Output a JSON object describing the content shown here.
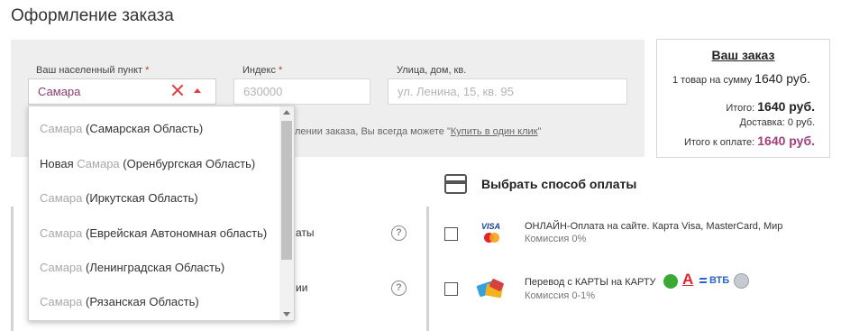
{
  "page": {
    "title": "Оформление заказа"
  },
  "form": {
    "city": {
      "label": "Ваш населенный пункт",
      "required_mark": "*",
      "value": "Самара"
    },
    "zip": {
      "label": "Индекс",
      "required_mark": "*",
      "placeholder": "630000"
    },
    "street": {
      "label": "Улица, дом, кв.",
      "placeholder": "ул. Ленина, 15, кв. 95"
    },
    "hint": {
      "text": "лении заказа, Вы всегда можете \"",
      "link": "Купить в один клик",
      "tail": "\""
    }
  },
  "order": {
    "title": "Ваш заказ",
    "summary_prefix": "1 товар на сумму",
    "summary_amount": "1640 руб.",
    "total_label": "Итого:",
    "total_amount": "1640 руб.",
    "delivery": "Доставка: 0 руб.",
    "pay_label": "Итого к оплате:",
    "pay_amount": "1640 руб.",
    "accent_color": "#a13e7b"
  },
  "city_dropdown": {
    "items": [
      {
        "pre": "",
        "match": "Самара",
        "post": " (Самарская Область)"
      },
      {
        "pre": "Новая ",
        "match": "Самара",
        "post": " (Оренбургская Область)"
      },
      {
        "pre": "",
        "match": "Самара",
        "post": " (Иркутская Область)"
      },
      {
        "pre": "",
        "match": "Самара",
        "post": " (Еврейская Автономная область)"
      },
      {
        "pre": "",
        "match": "Самара",
        "post": " (Ленинградская Область)"
      },
      {
        "pre": "",
        "match": "Самара",
        "post": " (Рязанская Область)"
      }
    ]
  },
  "delivery_partial": {
    "row1": "аты",
    "row2": "ии"
  },
  "payment": {
    "header": "Выбрать способ оплаты",
    "options": [
      {
        "title": "ОНЛАЙН-Оплата на сайте. Карта Visa, MasterCard, Мир",
        "commission": "Комиссия 0%",
        "icon": "visa-mastercard-icon"
      },
      {
        "title": "Перевод с КАРТЫ на КАРТУ",
        "commission": "Комиссия 0-1%",
        "icon": "bank-cards-icon"
      }
    ],
    "banks": {
      "alfa": "А",
      "vtb": "ВТБ"
    },
    "visa_text": "VISA"
  }
}
